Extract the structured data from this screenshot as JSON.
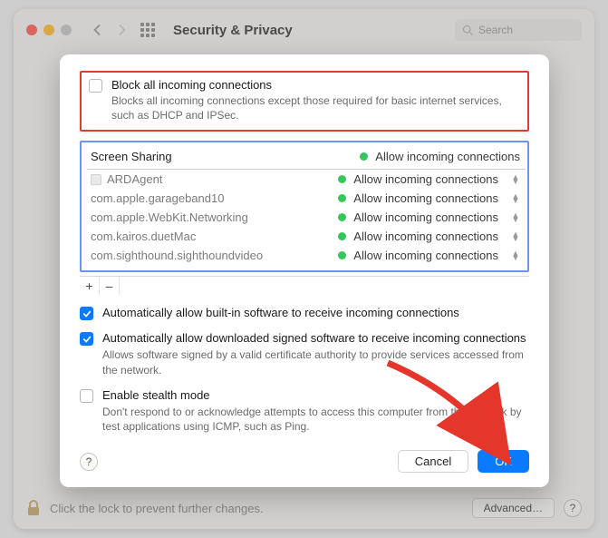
{
  "titlebar": {
    "title": "Security & Privacy",
    "search_placeholder": "Search"
  },
  "sheet": {
    "block_all": {
      "label": "Block all incoming connections",
      "desc": "Blocks all incoming connections except those required for basic internet services, such as DHCP and IPSec.",
      "checked": false
    },
    "apps": {
      "header_name": "Screen Sharing",
      "header_status": "Allow incoming connections",
      "rows": [
        {
          "name": "ARDAgent",
          "status": "Allow incoming connections",
          "has_icon": true
        },
        {
          "name": "com.apple.garageband10",
          "status": "Allow incoming connections",
          "has_icon": false
        },
        {
          "name": "com.apple.WebKit.Networking",
          "status": "Allow incoming connections",
          "has_icon": false
        },
        {
          "name": "com.kairos.duetMac",
          "status": "Allow incoming connections",
          "has_icon": false
        },
        {
          "name": "com.sighthound.sighthoundvideo",
          "status": "Allow incoming connections",
          "has_icon": false
        }
      ],
      "add_label": "+",
      "remove_label": "–"
    },
    "auto_builtin": {
      "label": "Automatically allow built-in software to receive incoming connections",
      "checked": true
    },
    "auto_signed": {
      "label": "Automatically allow downloaded signed software to receive incoming connections",
      "desc": "Allows software signed by a valid certificate authority to provide services accessed from the network.",
      "checked": true
    },
    "stealth": {
      "label": "Enable stealth mode",
      "desc": "Don't respond to or acknowledge attempts to access this computer from the network by test applications using ICMP, such as Ping.",
      "checked": false
    },
    "help": "?",
    "cancel": "Cancel",
    "ok": "OK"
  },
  "footer": {
    "text": "Click the lock to prevent further changes.",
    "advanced": "Advanced…",
    "help": "?"
  }
}
